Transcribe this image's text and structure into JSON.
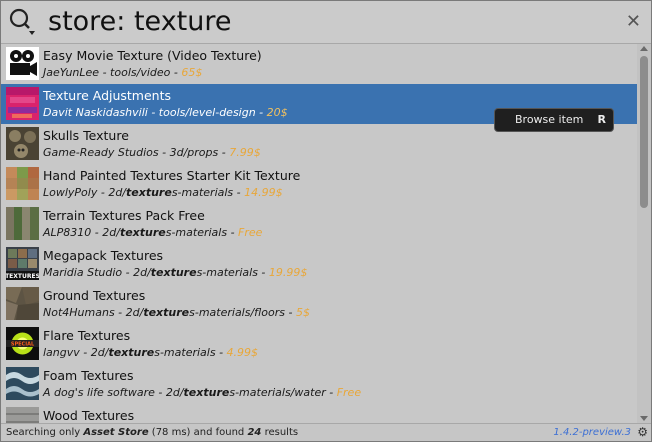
{
  "search": {
    "query": "store: texture"
  },
  "close_glyph": "✕",
  "tooltip": {
    "label": "Browse item",
    "key": "R"
  },
  "items": [
    {
      "title": "Easy Movie Texture (Video Texture)",
      "author": "JaeYunLee",
      "path_pre": "tools/video",
      "path_bold": "",
      "path_post": "",
      "price": "65$",
      "thumb": "film-projector"
    },
    {
      "title": "Texture Adjustments",
      "author": "Davit Naskidashvili",
      "path_pre": "tools/level-design",
      "path_bold": "",
      "path_post": "",
      "price": "20$",
      "thumb": "color-adjust",
      "selected": true
    },
    {
      "title": "Skulls Texture",
      "author": "Game-Ready Studios",
      "path_pre": "3d/props",
      "path_bold": "",
      "path_post": "",
      "price": "7.99$",
      "thumb": "skulls"
    },
    {
      "title": "Hand Painted Textures Starter Kit Texture",
      "author": "LowlyPoly",
      "path_pre": "2d/",
      "path_bold": "texture",
      "path_post": "s-materials",
      "price": "14.99$",
      "thumb": "hand-painted"
    },
    {
      "title": "Terrain Textures Pack Free",
      "author": "ALP8310",
      "path_pre": "2d/",
      "path_bold": "texture",
      "path_post": "s-materials",
      "price": "Free",
      "thumb": "terrain"
    },
    {
      "title": "Megapack Textures",
      "author": "Maridia Studio",
      "path_pre": "2d/",
      "path_bold": "texture",
      "path_post": "s-materials",
      "price": "19.99$",
      "thumb": "megapack"
    },
    {
      "title": "Ground Textures",
      "author": "Not4Humans",
      "path_pre": "2d/",
      "path_bold": "texture",
      "path_post": "s-materials/floors",
      "price": "5$",
      "thumb": "ground"
    },
    {
      "title": "Flare Textures",
      "author": "langvv",
      "path_pre": "2d/",
      "path_bold": "texture",
      "path_post": "s-materials",
      "price": "4.99$",
      "thumb": "flare"
    },
    {
      "title": "Foam Textures",
      "author": "A dog's life software",
      "path_pre": "2d/",
      "path_bold": "texture",
      "path_post": "s-materials/water",
      "price": "Free",
      "thumb": "foam"
    },
    {
      "title": "Wood Textures",
      "author": "",
      "path_pre": "",
      "path_bold": "",
      "path_post": "",
      "price": "",
      "thumb": "wood"
    }
  ],
  "thumb_text": {
    "megapack": "TEXTURES",
    "flare": "SPECIAL"
  },
  "status": {
    "prefix": "Searching only ",
    "provider": "Asset Store",
    "mid": " (78 ms) and found ",
    "count": "24",
    "suffix": " results",
    "version": "1.4.2-preview.3",
    "gear_glyph": "⚙"
  },
  "colors": {
    "selection": "#3a72b0",
    "price": "#e8a73a",
    "version": "#3c6fd4"
  }
}
